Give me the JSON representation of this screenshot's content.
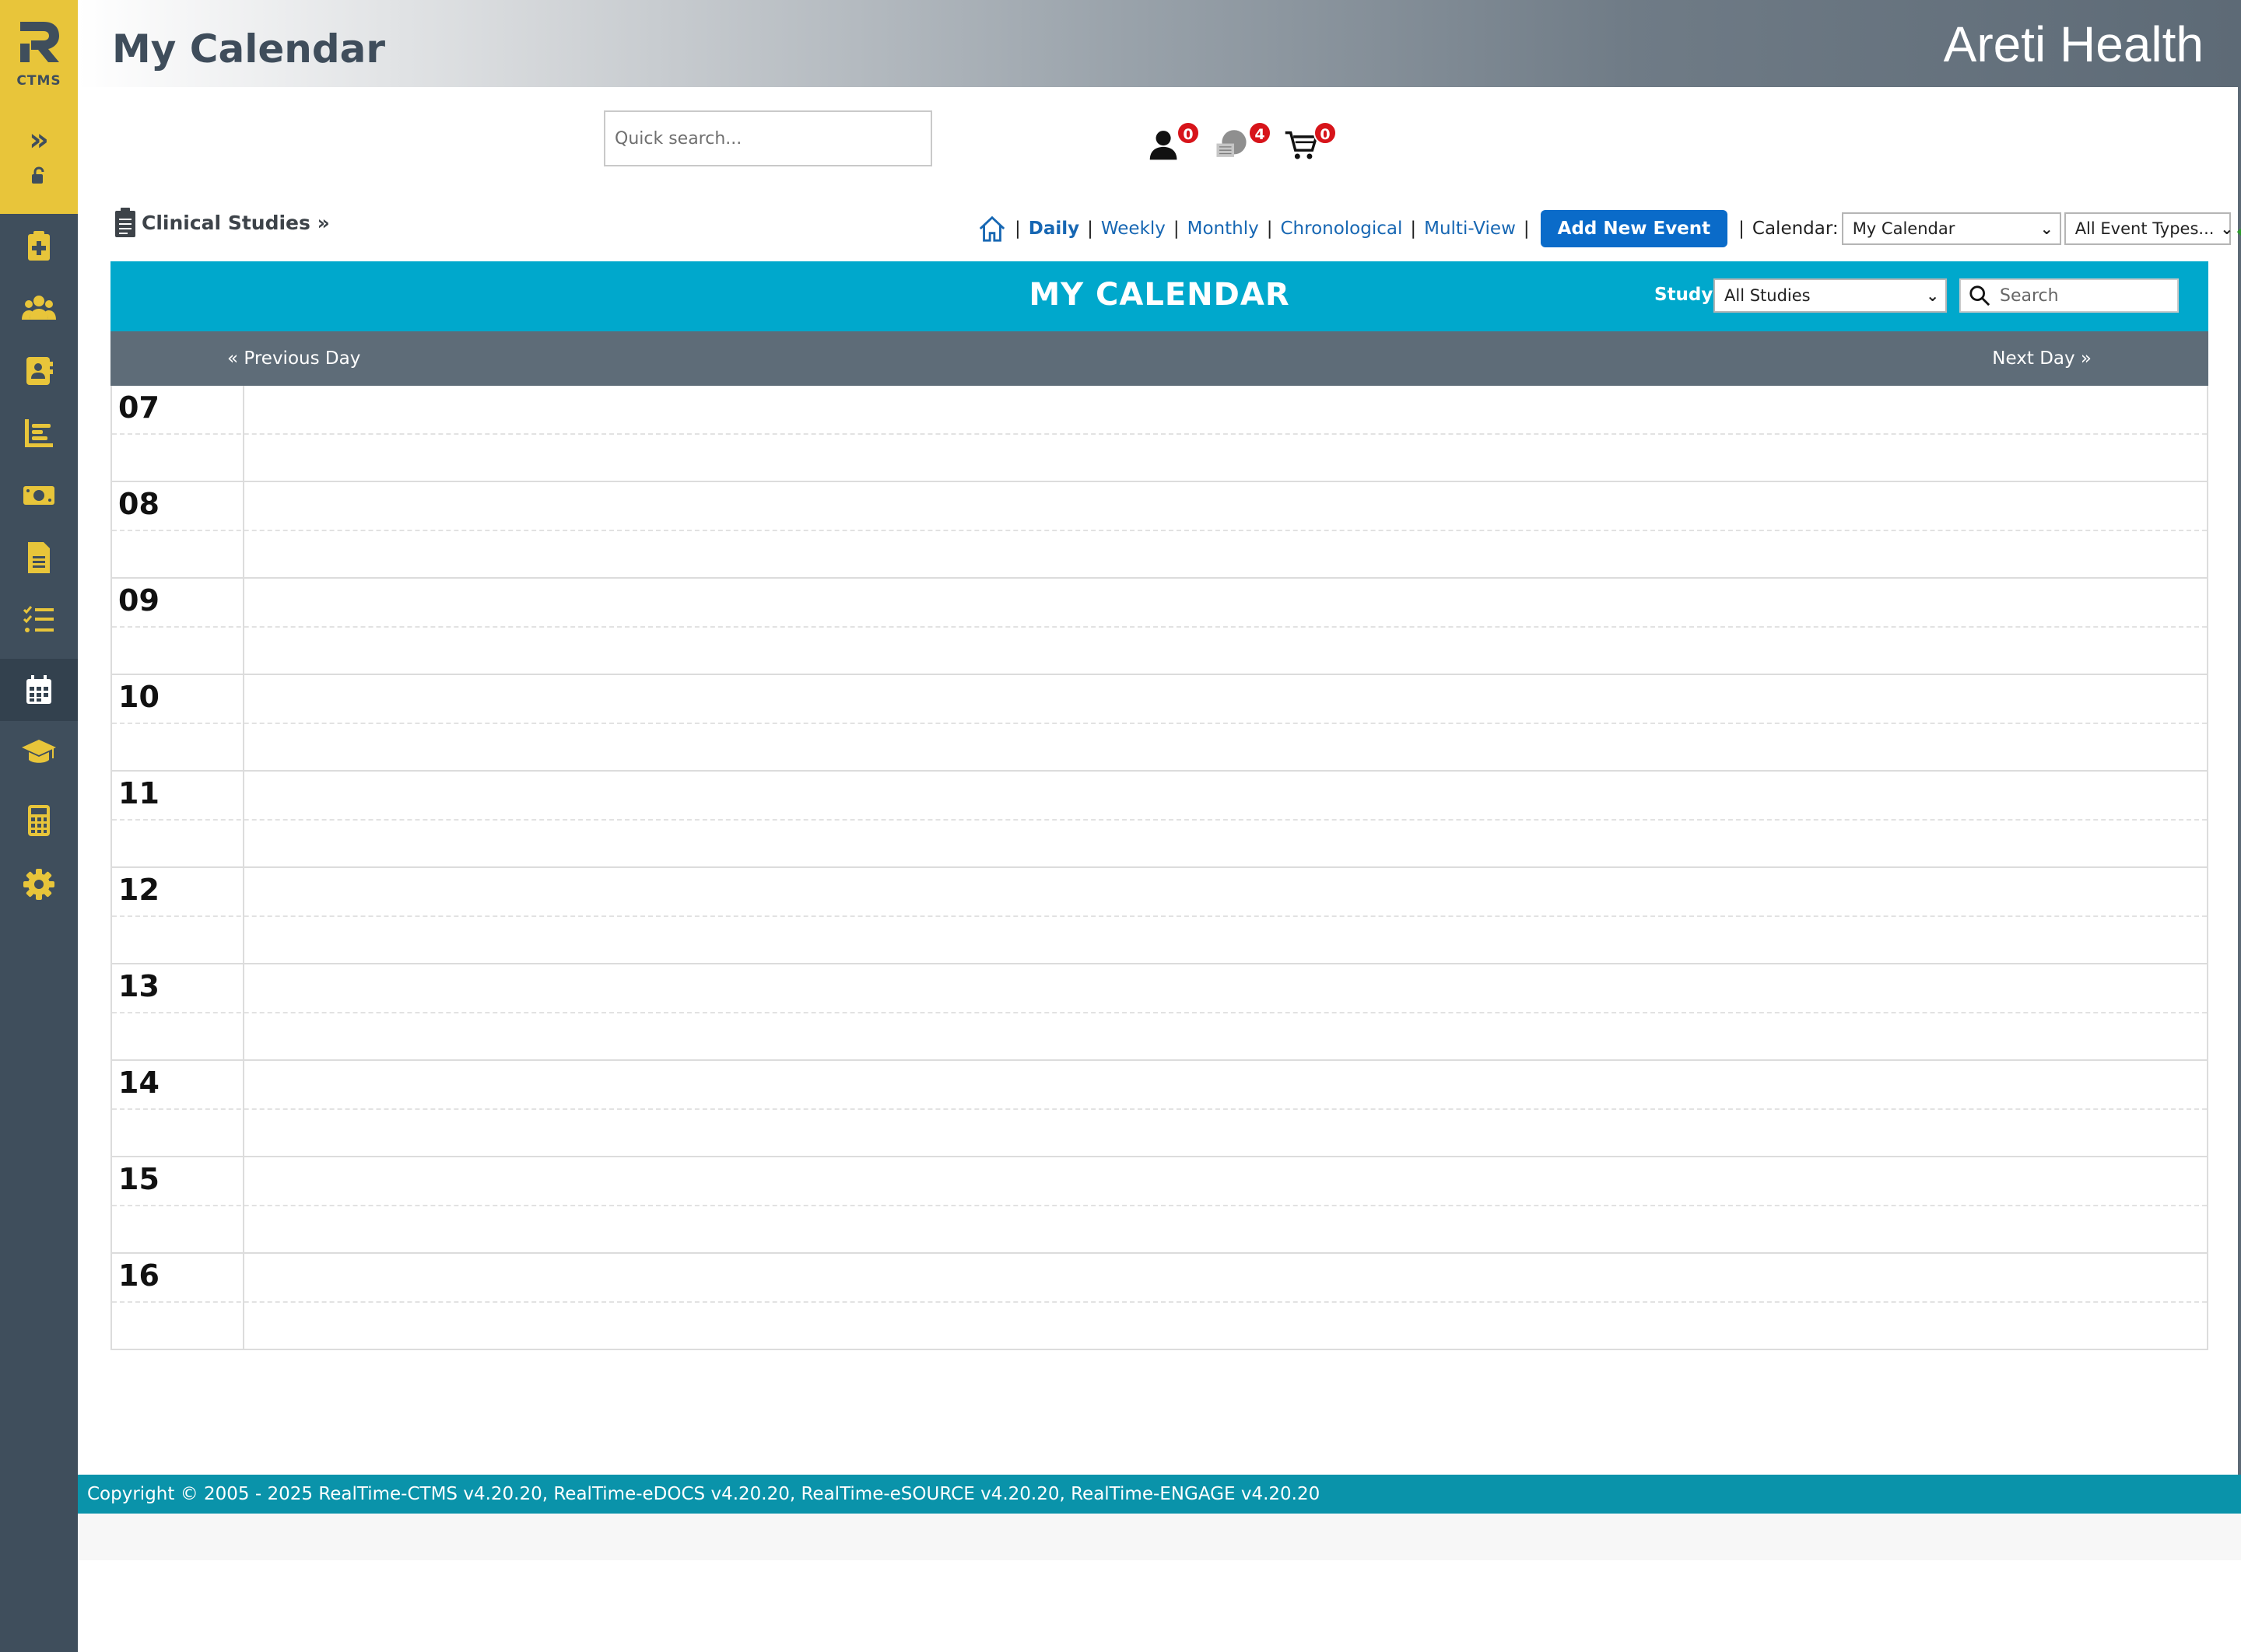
{
  "app": {
    "logo_text": "CTMS",
    "page_title": "My Calendar",
    "company_name": "Areti Health"
  },
  "sidebar": {
    "items": [
      {
        "icon": "clipboard-plus-icon"
      },
      {
        "icon": "users-icon"
      },
      {
        "icon": "contact-card-icon"
      },
      {
        "icon": "bar-chart-icon"
      },
      {
        "icon": "money-icon"
      },
      {
        "icon": "document-icon"
      },
      {
        "icon": "checklist-icon"
      },
      {
        "icon": "calendar-icon",
        "active": true
      },
      {
        "icon": "graduation-cap-icon"
      },
      {
        "icon": "calculator-icon"
      },
      {
        "icon": "gear-icon"
      }
    ]
  },
  "search": {
    "placeholder": "Quick search..."
  },
  "notifications": {
    "people_count": "0",
    "messages_count": "4",
    "cart_count": "0"
  },
  "breadcrumb": {
    "label": "Clinical Studies »"
  },
  "toolbar": {
    "views": [
      "Daily",
      "Weekly",
      "Monthly",
      "Chronological",
      "Multi-View"
    ],
    "active_view": "Daily",
    "add_event_label": "Add New Event",
    "calendar_label": "Calendar:",
    "calendar_value": "My Calendar",
    "event_types_value": "All Event Types...",
    "separator": "|"
  },
  "calendar": {
    "title": "MY CALENDAR",
    "study_label": "Study:",
    "study_value": "All Studies",
    "search_placeholder": "Search",
    "prev_label": "« Previous Day",
    "next_label": "Next Day »",
    "hours": [
      "07",
      "08",
      "09",
      "10",
      "11",
      "12",
      "13",
      "14",
      "15",
      "16"
    ]
  },
  "footer": {
    "copyright": "Copyright © 2005 - 2025 RealTime-CTMS v4.20.20, RealTime-eDOCS v4.20.20, RealTime-eSOURCE v4.20.20, RealTime-ENGAGE v4.20.20"
  },
  "colors": {
    "brand_yellow": "#e8c53a",
    "sidebar_dark": "#3f4e5c",
    "calendar_band": "#00a8cc",
    "nav_band": "#5e6c78",
    "footer": "#0a93aa",
    "link_blue": "#1767b3",
    "badge_red": "#d7141a"
  }
}
